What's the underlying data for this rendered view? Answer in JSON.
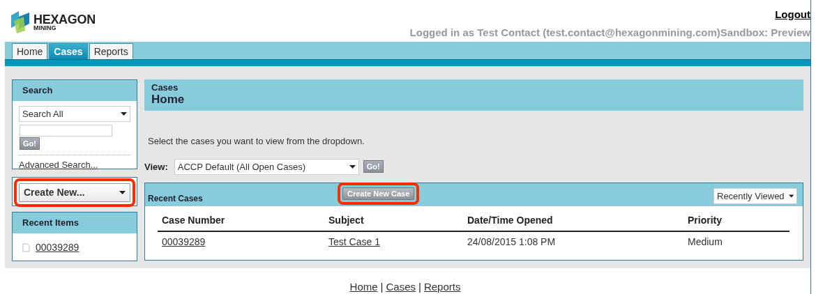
{
  "logo": {
    "name": "HEXAGON",
    "sub": "MINING"
  },
  "header": {
    "logout": "Logout",
    "login_info": "Logged in as Test Contact (test.contact@hexagonmining.com)Sandbox: Preview"
  },
  "tabs": [
    {
      "label": "Home",
      "selected": false
    },
    {
      "label": "Cases",
      "selected": true
    },
    {
      "label": "Reports",
      "selected": false
    }
  ],
  "sidebar": {
    "search": {
      "title": "Search",
      "scope": "Search All",
      "button": "Go!",
      "advanced_link": "Advanced Search..."
    },
    "create_new": {
      "label": "Create New...",
      "highlighted": true
    },
    "recent_items": {
      "title": "Recent Items",
      "items": [
        "00039289"
      ]
    }
  },
  "main": {
    "breadcrumb": "Cases",
    "title": "Home",
    "instructions": "Select the cases you want to view from the dropdown.",
    "view": {
      "label": "View:",
      "value": "ACCP Default (All Open Cases)",
      "button": "Go!"
    },
    "recent_cases": {
      "title": "Recent Cases",
      "new_button": {
        "label": "Create New Case",
        "highlighted": true
      },
      "filter": "Recently Viewed",
      "columns": [
        "Case Number",
        "Subject",
        "Date/Time Opened",
        "Priority"
      ],
      "rows": [
        [
          "00039289",
          "Test Case 1",
          "24/08/2015 1:08 PM",
          "Medium"
        ]
      ]
    }
  },
  "footer": {
    "links": [
      "Home",
      "Cases",
      "Reports"
    ],
    "separator": "|"
  }
}
